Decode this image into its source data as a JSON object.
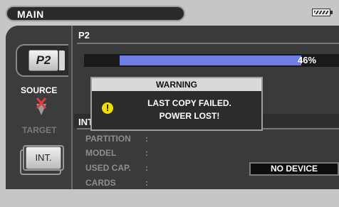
{
  "topbar": {
    "mode_label": "MAIN",
    "battery_icon": "battery-icon"
  },
  "source_panel": {
    "card_label": "P2",
    "source_label": "SOURCE",
    "target_label": "TARGET",
    "int_button_label": "INT."
  },
  "p2_section": {
    "header": "P2",
    "progress_text": "46%",
    "progress_value": 0.46
  },
  "int_section": {
    "header": "INT",
    "fields": [
      {
        "label": "PARTITION",
        "colon": ":"
      },
      {
        "label": "MODEL",
        "colon": ":"
      },
      {
        "label": "USED CAP.",
        "colon": ":"
      },
      {
        "label": "CARDS",
        "colon": ":"
      }
    ],
    "status": "NO DEVICE"
  },
  "dialog": {
    "title": "WARNING",
    "line1": "LAST COPY FAILED.",
    "line2": "POWER LOST!",
    "icon": "!"
  },
  "colors": {
    "progress_fill": "#6f7de6",
    "warning_icon": "#f0e000",
    "cancel_x": "#e23b3b"
  }
}
